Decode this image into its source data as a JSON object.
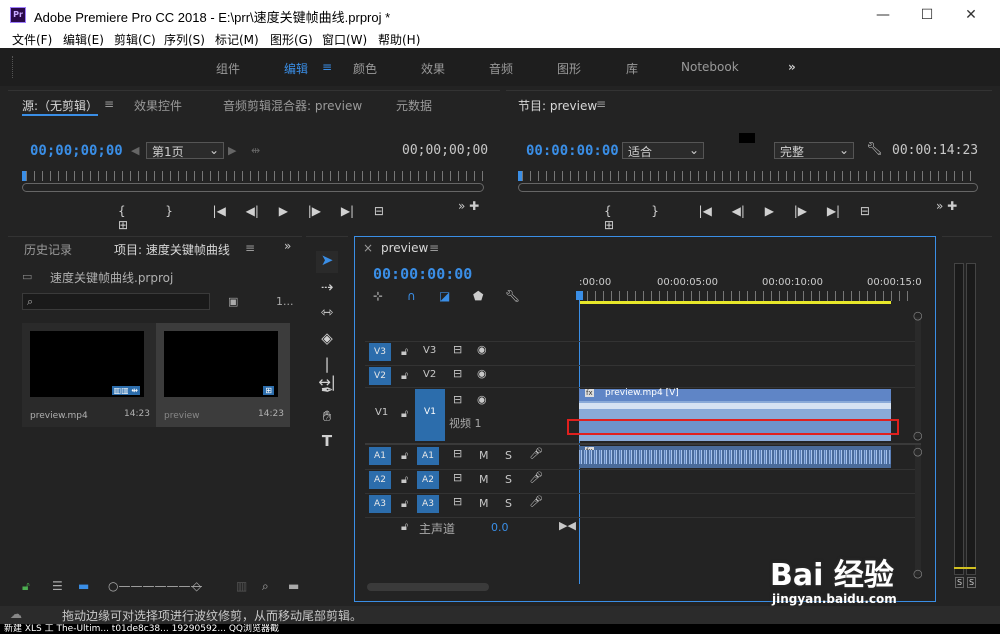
{
  "app": {
    "title": "Adobe Premiere Pro CC 2018 - E:\\prr\\速度关键帧曲线.prproj *",
    "logo": "Pr"
  },
  "window_controls": {
    "minimize": "—",
    "maximize": "☐",
    "close": "✕"
  },
  "menu": [
    "文件(F)",
    "编辑(E)",
    "剪辑(C)",
    "序列(S)",
    "标记(M)",
    "图形(G)",
    "窗口(W)",
    "帮助(H)"
  ],
  "workspaces": {
    "items": [
      "组件",
      "编辑",
      "颜色",
      "效果",
      "音频",
      "图形",
      "库",
      "Notebook"
    ],
    "active": "编辑",
    "more": "»"
  },
  "source_panel": {
    "tabs": [
      "源:（无剪辑）",
      "效果控件",
      "音频剪辑混合器: preview",
      "元数据"
    ],
    "timecode_left": "00;00;00;00",
    "timecode_right": "00;00;00;00",
    "page_select": "第1页"
  },
  "program_panel": {
    "title": "节目: preview",
    "timecode_left": "00:00:00:00",
    "fit_select": "适合",
    "quality_select": "完整",
    "timecode_right": "00:00:14:23"
  },
  "project_panel": {
    "tabs": [
      "历史记录",
      "项目: 速度关键帧曲线"
    ],
    "project_file": "速度关键帧曲线.prproj",
    "item_count": "1...",
    "items": [
      {
        "name": "preview.mp4",
        "duration": "14:23"
      },
      {
        "name": "preview",
        "duration": "14:23"
      }
    ]
  },
  "timeline": {
    "tab": "preview",
    "timecode": "00:00:00:00",
    "ruler_labels": [
      ":00:00",
      "00:00:05:00",
      "00:00:10:00",
      "00:00:15:0"
    ],
    "video_tracks": [
      {
        "src": "V3",
        "dst": "V3"
      },
      {
        "src": "V2",
        "dst": "V2"
      },
      {
        "src": "V1",
        "dst": "V1",
        "name": "视频 1"
      }
    ],
    "audio_tracks": [
      {
        "src": "A1",
        "dst": "A1"
      },
      {
        "src": "A2",
        "dst": "A2"
      },
      {
        "src": "A3",
        "dst": "A3"
      }
    ],
    "mute_label": "M",
    "solo_label": "S",
    "master": {
      "label": "主声道",
      "value": "0.0"
    },
    "video_clip_label": "preview.mp4 [V]",
    "fx_badge": "fx"
  },
  "meters": {
    "solo_labels": [
      "S",
      "S"
    ]
  },
  "status_text": "拖动边缘可对选择项进行波纹修剪，从而移动尾部剪辑。",
  "taskbar_text": "新建 XLS 工    The-Ultim...    t01de8c38...    19290592...    QQ浏览器截",
  "watermark": {
    "text": "Bai 经验",
    "url": "jingyan.baidu.com"
  }
}
